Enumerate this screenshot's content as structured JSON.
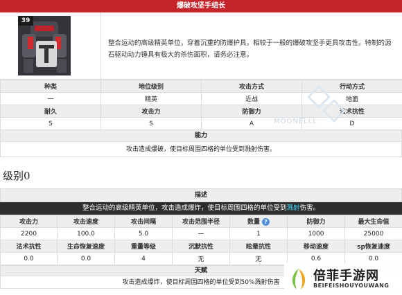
{
  "card": {
    "title": "爆破攻坚手组长",
    "level": "39",
    "description": "整合运动的高级精英单位，穿着沉重的防爆护具，相较于一般的爆破攻坚手更具攻击性。特制的源石驱动动力锤具有极大的杀伤面积，请务必注意。",
    "stats_headers_1": [
      "种类",
      "地位级别",
      "攻击方式",
      "行动方式"
    ],
    "stats_values_1": [
      "一",
      "精英",
      "近战",
      "地面"
    ],
    "stats_headers_2": [
      "耐久",
      "攻击力",
      "防御力",
      "法术抗性"
    ],
    "stats_values_2": [
      "S",
      "S",
      "A",
      "D"
    ],
    "ability_header": "能力",
    "ability_text": "攻击造成爆破，使目标周围四格的单位受到溅射伤害。",
    "watermark": "MOONELLL"
  },
  "section": {
    "title": "级别0"
  },
  "level_table": {
    "desc_header": "描述",
    "desc_before": "整合运动的高级精英单位，攻击造成爆炸，使目标周围四格的单位受到",
    "desc_highlight": "溅射",
    "desc_after": "伤害。",
    "headers_1": [
      "攻击力",
      "攻击速度",
      "攻击间隔",
      "攻击范围半径",
      "数量",
      "防御力",
      "最大生命值"
    ],
    "values_1": [
      "2200",
      "100.0",
      "5.0",
      "一",
      "1",
      "1000",
      "25000"
    ],
    "headers_2": [
      "法术抗性",
      "生命恢复速度",
      "重量等级",
      "沉默抗性",
      "眩晕抗性",
      "移动速度",
      "sp恢复速度"
    ],
    "values_2": [
      "0.0",
      "0.0",
      "4",
      "无",
      "无",
      "0.6",
      "0.0"
    ],
    "info_icon": "?",
    "talent_header": "天赋",
    "talent_text": "攻击造成爆炸，使目标周围四格的单位受到50%溅射伤害"
  },
  "site_logo": {
    "name_cn": "倍菲手游网",
    "name_en": "BEIFEISHOUYOUWANG"
  },
  "colors": {
    "title_bar": "#c6242b",
    "header_cell": "#eeeeee",
    "dark_row": "#2e2e2e",
    "highlight": "#3fd6ff"
  }
}
